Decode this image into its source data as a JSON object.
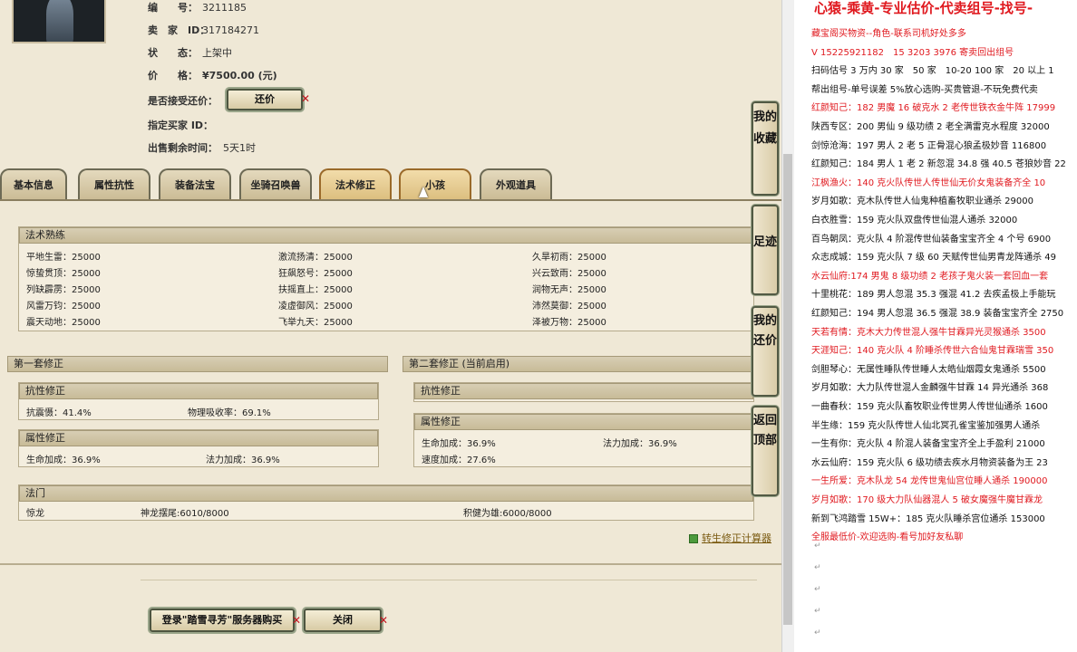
{
  "left": {
    "info": [
      {
        "key": "编　　号：",
        "val": "3211185"
      },
      {
        "key": "卖　家　ID：",
        "val": "317184271"
      },
      {
        "key": "状　　态：",
        "val": "上架中"
      },
      {
        "key": "价　　格：",
        "val": "¥7500.00 (元)"
      },
      {
        "key": "是否接受还价：",
        "val": ""
      },
      {
        "key": "指定买家 ID：",
        "val": ""
      },
      {
        "key": "出售剩余时间：",
        "val": "5天1时"
      }
    ],
    "bargain_btn": "还价",
    "tabs": [
      "基本信息",
      "属性抗性",
      "装备法宝",
      "坐骑召唤兽",
      "法术修正",
      "小孩",
      "外观道具"
    ],
    "skill_title": "法术熟练",
    "skills": [
      [
        "平地生雷：25000",
        "激流扬清：25000",
        "久旱初雨：25000"
      ],
      [
        "惊蛰贯顶：25000",
        "狂飙怒号：25000",
        "兴云致雨：25000"
      ],
      [
        "列缺霹雳：25000",
        "扶摇直上：25000",
        "润物无声：25000"
      ],
      [
        "风雷万钧：25000",
        "凌虚御风：25000",
        "沛然莫御：25000"
      ],
      [
        "震天动地：25000",
        "飞举九天：25000",
        "泽被万物：25000"
      ]
    ],
    "set1_title": "第一套修正",
    "set2_title": "第二套修正 (当前启用)",
    "resist_title": "抗性修正",
    "attr_title": "属性修正",
    "set1_resist": [
      "抗震慑：41.4%",
      "物理吸收率：69.1%"
    ],
    "set1_attr": [
      "生命加成：36.9%",
      "法力加成：36.9%"
    ],
    "set2_attr": [
      "生命加成：36.9%",
      "法力加成：36.9%",
      "速度加成：27.6%"
    ],
    "fame_title": "法门",
    "fame": [
      "惊龙",
      "神龙摆尾:6010/8000",
      "积健为雄:6000/8000"
    ],
    "calc_link": "转生修正计算器",
    "login_btn": "登录\"踏雪寻芳\"服务器购买",
    "close_btn": "关闭",
    "side": [
      "我的收藏",
      "足迹",
      "我的还价",
      "返回顶部"
    ]
  },
  "right": {
    "title": "心猿-乘黄-专业估价-代卖组号-找号-",
    "lines": [
      {
        "t": "藏宝阁买物资--角色-联系司机好处多多",
        "red": true
      },
      {
        "t": "V 15225921182　15 3203 3976 寄卖回出组号",
        "red": true
      },
      {
        "t": "扫码估号 3 万内 30 家　50 家　10-20 100 家　20 以上 1",
        "red": false
      },
      {
        "t": "帮出组号-单号误差 5%放心选购-买贵管退-不玩免费代卖",
        "red": false
      },
      {
        "t": "红颜知己：182 男魔 16 破克水 2 老传世铁衣金牛阵 17999",
        "red": true
      },
      {
        "t": "陕西专区：200 男仙 9 级功绩 2 老全满雷克水程度 32000",
        "red": false
      },
      {
        "t": "剑惊沧海：197 男人 2 老 5 正骨混心狼孟极妙音 116800",
        "red": false
      },
      {
        "t": "红颜知己：184 男人 1 老 2 新忽混 34.8 强 40.5 苍狼妙音 22",
        "red": false
      },
      {
        "t": "江枫渔火：140 克火队传世人传世仙无价女鬼装备齐全 10",
        "red": true
      },
      {
        "t": "岁月如歌：克木队传世人仙鬼种植畜牧职业通杀 29000",
        "red": false
      },
      {
        "t": "白衣胜雪：159 克火队双盘传世仙混人通杀 32000",
        "red": false
      },
      {
        "t": "百鸟朝凤：克火队 4 阶混传世仙装备宝宝齐全 4 个号 6900",
        "red": false
      },
      {
        "t": "众志成城：159 克火队 7 级 60 天赋传世仙男青龙阵通杀 49",
        "red": false
      },
      {
        "t": "水云仙府:174 男鬼 8 级功绩 2 老孩子鬼火装一套回血一套",
        "red": true
      },
      {
        "t": "十里桃花：189 男人忽混 35.3 强混 41.2 去疾孟极上手能玩",
        "red": false
      },
      {
        "t": "红颜知己：194 男人忽混 36.5 强混 38.9 装备宝宝齐全 2750",
        "red": false
      },
      {
        "t": "天若有情：克木大力传世混人强牛甘霖异光灵猴通杀 3500",
        "red": true
      },
      {
        "t": "天涯知己：140 克火队 4 阶睡杀传世六合仙鬼甘霖瑞雪 350",
        "red": true
      },
      {
        "t": "剑胆琴心：无属性睡队传世睡人太皓仙烟霞女鬼通杀 5500",
        "red": false
      },
      {
        "t": "岁月如歌：大力队传世混人金麟强牛甘霖 14 异光通杀 368",
        "red": false
      },
      {
        "t": "一曲春秋：159 克火队畜牧职业传世男人传世仙通杀 1600",
        "red": false
      },
      {
        "t": "半生缘：159 克火队传世人仙北冥孔雀宝鉴加强男人通杀",
        "red": false
      },
      {
        "t": "一生有你：克火队 4 阶混人装备宝宝齐全上手盈利 21000",
        "red": false
      },
      {
        "t": "水云仙府：159 克火队 6 级功绩去疾水月物资装备为王 23",
        "red": false
      },
      {
        "t": "一生所爱：克木队龙 54 龙传世鬼仙宫位睡人通杀 190000",
        "red": true
      },
      {
        "t": "岁月如歌：170 级大力队仙器混人 5 破女魔强牛魔甘霖龙",
        "red": true
      },
      {
        "t": "新到飞鸿踏雪 15W+：185 克火队睡杀宫位通杀 153000",
        "red": false
      },
      {
        "t": "全服最低价-欢迎选购-看号加好友私聊",
        "red": true
      }
    ],
    "return_mark": "↵"
  }
}
